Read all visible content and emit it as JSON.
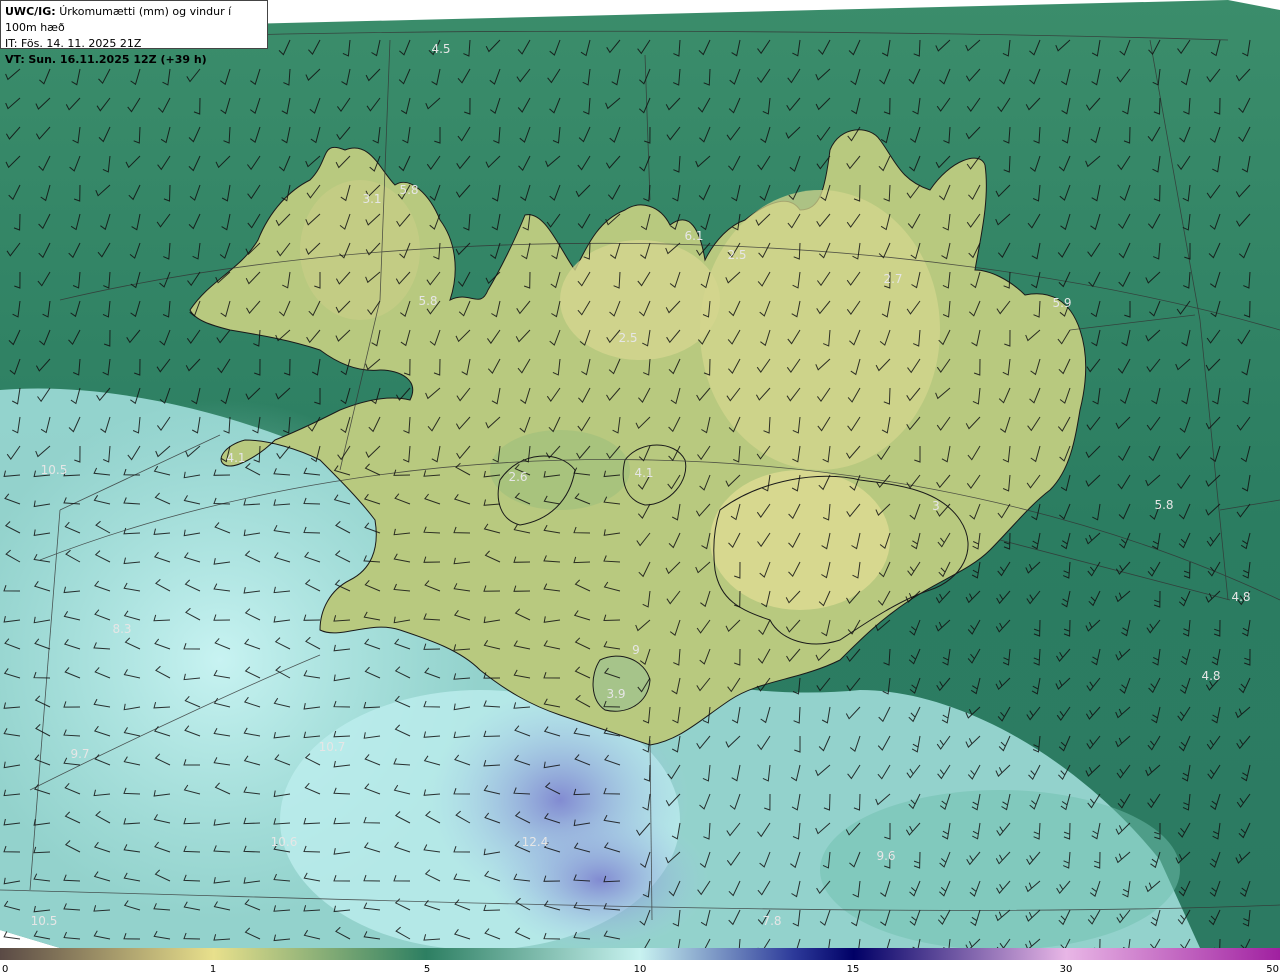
{
  "header": {
    "product": "UWC/IG:",
    "title": "Úrkomumætti (mm) og vindur í 100m hæð",
    "it_label": "IT:",
    "it_value": "Fös. 14. 11. 2025 21Z",
    "vt_label": "VT:",
    "vt_value": "Sun. 16.11.2025 12Z (+39 h)"
  },
  "map": {
    "region": "Iceland",
    "colors": {
      "ocean_dry": "#2c7d60",
      "land_dry": "#cfd48a",
      "ocean_wet": "#a8e6e4",
      "wettest": "#7f86d0"
    },
    "value_labels": [
      "4.5",
      "5.8",
      "3.1",
      "5.8",
      "6.1",
      "2.5",
      "2.7",
      "5.9",
      "2.5",
      "4.1",
      "10.5",
      "2.6",
      "4.1",
      "5.8",
      "4.8",
      "8.3",
      "4.8",
      "3.9",
      "9",
      "10.7",
      "10.6",
      "12.4",
      "9.6",
      "7.8",
      "10.5",
      "9.7",
      "3"
    ]
  },
  "colorbar": {
    "ticks": [
      "0",
      "1",
      "5",
      "10",
      "15",
      "30",
      "50"
    ],
    "colors": [
      "#5a4a45",
      "#e8e08c",
      "#2d7f62",
      "#c8f2f0",
      "#2d3a9a",
      "#000066",
      "#e8b6e6",
      "#a020a0"
    ]
  }
}
